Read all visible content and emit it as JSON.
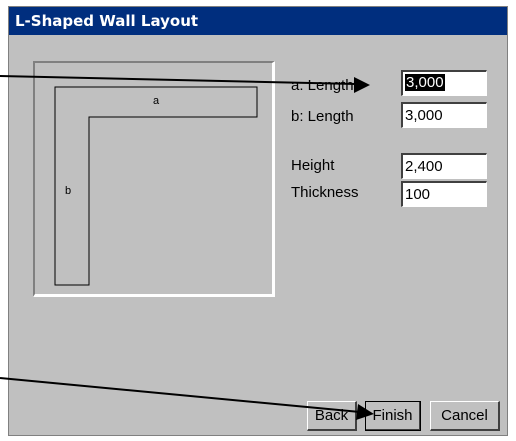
{
  "dialog": {
    "title": "L-Shaped Wall Layout"
  },
  "preview": {
    "label_a": "a",
    "label_b": "b"
  },
  "fields": [
    {
      "label": "a: Length",
      "value": "3,000",
      "selected": true
    },
    {
      "label": "b: Length",
      "value": "3,000"
    },
    {
      "label": "Height",
      "value": "2,400"
    },
    {
      "label": "Thickness",
      "value": "100"
    }
  ],
  "buttons": {
    "back": "Back",
    "finish": "Finish",
    "cancel": "Cancel"
  },
  "colors": {
    "title_bar": "#002e7e",
    "dialog_bg": "#c0c0c0"
  }
}
